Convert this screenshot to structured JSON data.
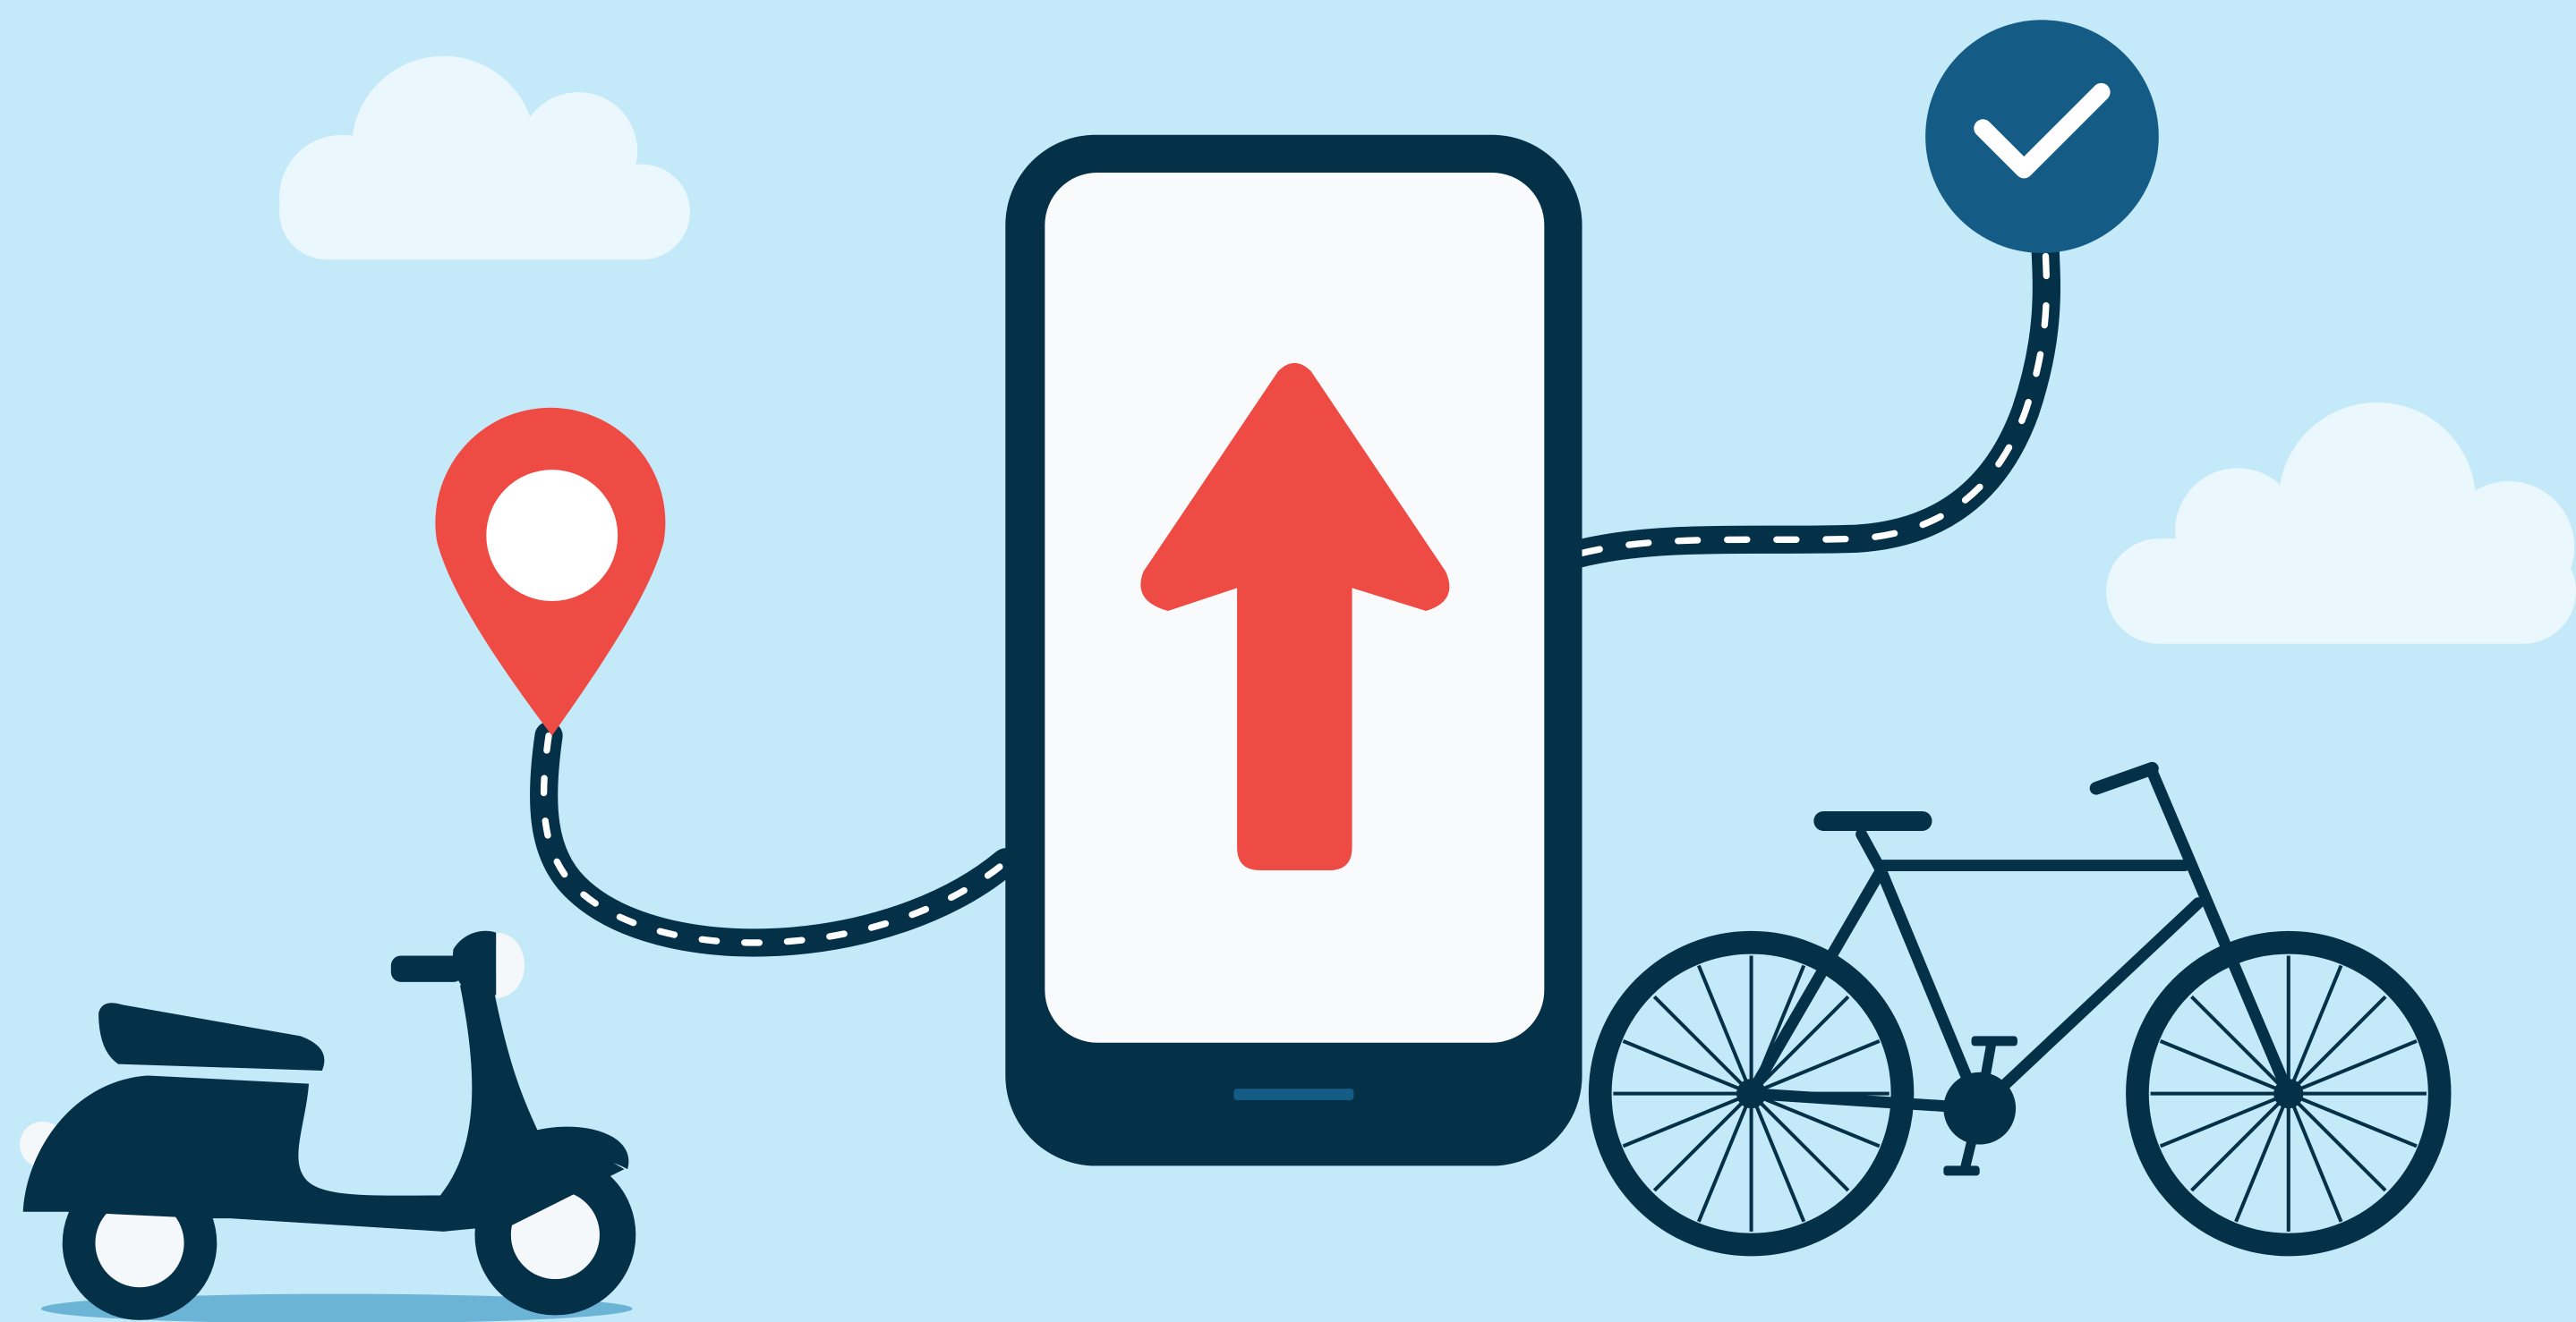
{
  "scene": {
    "background_color": "#c4e9f8",
    "colors": {
      "navy": "#043048",
      "red": "#ef4b45",
      "white": "#ffffff",
      "check_badge": "#145c86",
      "cloud": "#eaf7fd",
      "ground_shadow": "#6cb4d6"
    },
    "elements": [
      {
        "name": "cloud",
        "count": 2
      },
      {
        "name": "smartphone",
        "screen_icon": "arrow-up-icon"
      },
      {
        "name": "location-pin-icon"
      },
      {
        "name": "checkmark-icon"
      },
      {
        "name": "dashed-route",
        "count": 2
      },
      {
        "name": "scooter-icon"
      },
      {
        "name": "bicycle-icon"
      }
    ]
  }
}
